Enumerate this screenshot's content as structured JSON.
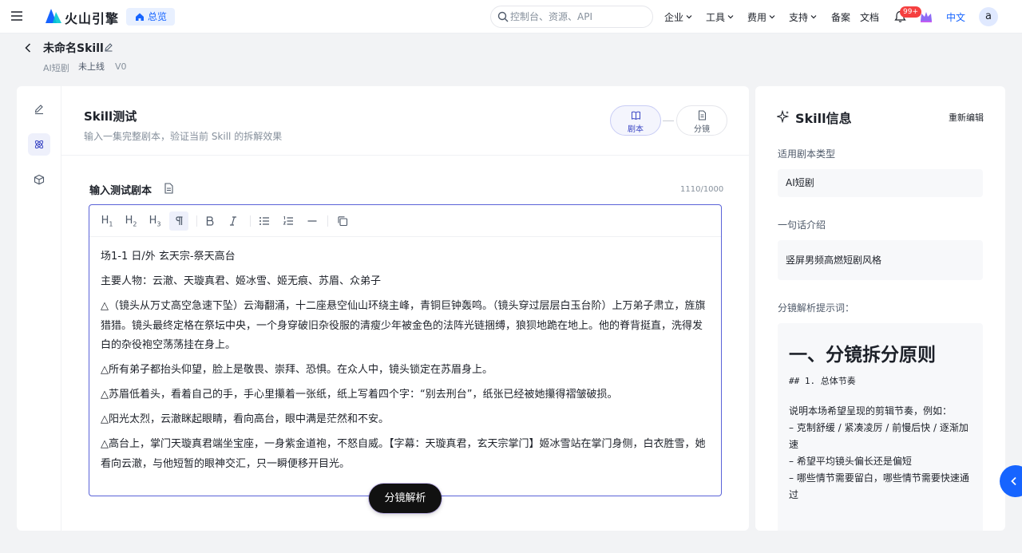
{
  "nav": {
    "brand": "火山引擎",
    "overview": "总览",
    "search_placeholder": "控制台、资源、API",
    "links": [
      "企业",
      "工具",
      "费用",
      "支持",
      "备案",
      "文档"
    ],
    "badge": "99+",
    "language": "中文",
    "avatar": "a"
  },
  "header": {
    "title": "未命名Skill",
    "category": "AI短剧",
    "status": "未上线",
    "version": "V0"
  },
  "main": {
    "title": "Skill测试",
    "subtitle": "输入一集完整剧本，验证当前 Skill 的拆解效果",
    "steps": [
      {
        "label": "剧本",
        "icon": "book-icon"
      },
      {
        "label": "分镜",
        "icon": "document-icon"
      }
    ],
    "section_label": "输入测试剧本",
    "counter": "1110/1000",
    "toolbar": {
      "h1": "H",
      "h2": "H",
      "h3": "H",
      "h1_sub": "1",
      "h2_sub": "2",
      "h3_sub": "3"
    },
    "script_lines": [
      "场1-1 日/外 玄天宗-祭天高台",
      "主要人物：云澈、天璇真君、姬冰雪、姬无痕、苏眉、众弟子",
      "△（镜头从万丈高空急速下坠）云海翻涌，十二座悬空仙山环绕主峰，青铜巨钟轰鸣。（镜头穿过层层白玉台阶）上万弟子肃立，旌旗猎猎。镜头最终定格在祭坛中央，一个身穿破旧杂役服的清瘦少年被金色的法阵光链捆缚，狼狈地跪在地上。他的脊背挺直，洗得发白的杂役袍空荡荡挂在身上。",
      "△所有弟子都抬头仰望，脸上是敬畏、崇拜、恐惧。在众人中，镜头锁定在苏眉身上。",
      "△苏眉低着头，看着自己的手，手心里攥着一张纸，纸上写着四个字：“别去刑台”，纸张已经被她攥得褶皱破损。",
      "△阳光太烈，云澈眯起眼睛，看向高台，眼中满是茫然和不安。",
      "△高台上，掌门天璇真君端坐宝座，一身紫金道袍，不怒自威。【字幕：天璇真君，玄天宗掌门】姬冰雪站在掌门身侧，白衣胜雪，她看向云澈，与他短暂的眼神交汇，只一瞬便移开目光。"
    ],
    "cta": "分镜解析"
  },
  "panel": {
    "title": "Skill信息",
    "action": "重新编辑",
    "type_label": "适用剧本类型",
    "type_value": "AI短剧",
    "intro_label": "一句话介绍",
    "intro_value": "竖屏男频高燃短剧风格",
    "prompt_label": "分镜解析提示词：",
    "prompt_heading": "一、分镜拆分原则",
    "prompt_sub": "## 1. 总体节奏",
    "prompt_body": [
      "说明本场希望呈现的剪辑节奏，例如：",
      "– 克制舒缓 / 紧凑凌厉 / 前慢后快 / 逐渐加速",
      "– 希望平均镜头偏长还是偏短",
      "– 哪些情节需要留白，哪些情节需要快速通过"
    ]
  },
  "colors": {
    "accent": "#1664ff",
    "editor_border": "#5a63d8",
    "badge": "#f53f3f"
  }
}
